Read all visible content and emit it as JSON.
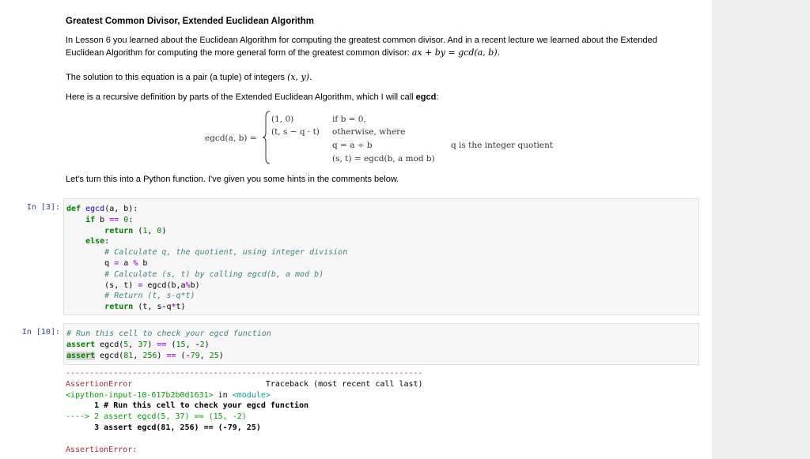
{
  "markdown": {
    "title": "Greatest Common Divisor, Extended Euclidean Algorithm",
    "p1_text": "In Lesson 6 you learned about the Euclidean Algorithm for computing the greatest common divisor. And in a recent lecture we learned about the Extended Euclidean Algorithm for computing the more general form of the greatest common divisor: ",
    "p1_math": "ax + by = gcd(a, b).",
    "p2_text": "The solution to this equation is a pair (a tuple) of integers ",
    "p2_math": "(x, y).",
    "p3_text": "Here is a recursive definition by parts of the Extended Euclidean Algorithm, which I will call ",
    "p3_bold": "egcd",
    "p3_tail": ":",
    "p4_text": "Let's turn this into a Python function. I've given you some hints in the comments below."
  },
  "equation": {
    "lhs": "egcd(a, b) =",
    "case1_value": "(1, 0)",
    "case1_cond": "if b = 0,",
    "case2_value": "(t, s − q · t)",
    "case2_cond": "otherwise, where",
    "line3": "q = a ÷ b",
    "line3_note": "q is the integer quotient",
    "line4": "(s, t) = egcd(b, a mod b)"
  },
  "cells": [
    {
      "prompt": "In [3]:",
      "lines": [
        "def egcd(a, b):",
        "    if b == 0:",
        "        return (1, 0)",
        "    else:",
        "        # Calculate q, the quotient, using integer division",
        "        q = a % b",
        "        # Calculate (s, t) by calling egcd(b, a mod b)",
        "        (s, t) = egcd(b,a%b)",
        "        # Return (t, s-q*t)",
        "        return (t, s-q*t)"
      ]
    },
    {
      "prompt": "In [10]:",
      "lines": [
        "# Run this cell to check your egcd function",
        "assert egcd(5, 37) == (15, -2)",
        "assert egcd(81, 256) == (-79, 25)"
      ]
    }
  ],
  "output": {
    "separator": "---------------------------------------------------------------------------",
    "error_name": "AssertionError",
    "traceback_label": "Traceback (most recent call last)",
    "input_ref": "<ipython-input-10-617b2b0d1631>",
    "in_word": " in ",
    "module": "<module>",
    "tb_line1": "      1 # Run this cell to check your egcd function",
    "tb_arrow": "----> 2 assert egcd(5, 37) == (15, -2)",
    "tb_line3": "      3 assert egcd(81, 256) == (-79, 25)",
    "final_error": "AssertionError:"
  }
}
